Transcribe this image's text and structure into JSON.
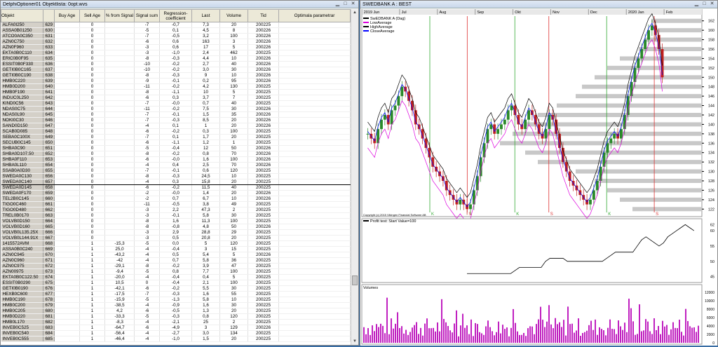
{
  "left_window": {
    "title": "DelphiOptioner01 Objektlista: 0opt.wvs"
  },
  "right_window": {
    "title": "SWEDBANK A : BEST"
  },
  "table": {
    "headers": [
      "Objekt",
      "",
      "Buy Age",
      "Sell Age",
      "% from Signal",
      "Signal sum",
      "Regression-coefficient",
      "Last",
      "Volume",
      "Tid",
      "Optimala parametrar"
    ],
    "rows": [
      [
        "ALFA0I250",
        "629",
        "",
        "0",
        "",
        "-7",
        "-0,7",
        "7,3",
        "20",
        "200225"
      ],
      [
        "ASSA0B01250",
        "630",
        "",
        "0",
        "",
        "-5",
        "0,1",
        "4,5",
        "8",
        "200226"
      ],
      [
        "ATCO0A0C350",
        "631",
        "",
        "0",
        "",
        "-7",
        "-0,5",
        "3,2",
        "100",
        "200226"
      ],
      [
        "AZN0C750",
        "632",
        "",
        "0",
        "",
        "-6",
        "0,6",
        "163",
        "3",
        "200226"
      ],
      [
        "AZN0F960",
        "633",
        "",
        "0",
        "",
        "-3",
        "0,6",
        "17",
        "5",
        "200226"
      ],
      [
        "EKTA0B0C110",
        "634",
        "",
        "0",
        "",
        "-3",
        "-1,0",
        "2,4",
        "462",
        "200225"
      ],
      [
        "ERIC0B0F95",
        "635",
        "",
        "0",
        "",
        "-8",
        "-0,3",
        "4,4",
        "10",
        "200226"
      ],
      [
        "ESSIT0B0F330",
        "636",
        "",
        "0",
        "",
        "-10",
        "-0,2",
        "2,7",
        "40",
        "200226"
      ],
      [
        "GETI0B0C165",
        "637",
        "",
        "0",
        "",
        "-10",
        "-0,2",
        "3,0",
        "30",
        "200226"
      ],
      [
        "GETI0B0C190",
        "638",
        "",
        "0",
        "",
        "-8",
        "-0,3",
        "9",
        "10",
        "200226"
      ],
      [
        "HMB0C220",
        "639",
        "",
        "0",
        "",
        "-9",
        "-0,1",
        "0,2",
        "95",
        "200226"
      ],
      [
        "HMB0D200",
        "640",
        "",
        "0",
        "",
        "-11",
        "-0,2",
        "4,2",
        "130",
        "200225"
      ],
      [
        "HMB0F190",
        "641",
        "",
        "0",
        "",
        "-8",
        "-1,1",
        "10",
        "5",
        "200225"
      ],
      [
        "INDUC0L250",
        "642",
        "",
        "0",
        "",
        "-6",
        "0,3",
        "3,7",
        "7",
        "200225"
      ],
      [
        "KIND0C56",
        "643",
        "",
        "0",
        "",
        "-7",
        "-0,0",
        "0,7",
        "40",
        "200225"
      ],
      [
        "NDAS0C75",
        "644",
        "",
        "0",
        "",
        "-11",
        "-0,2",
        "7,5",
        "30",
        "200226"
      ],
      [
        "NDAS0L90",
        "645",
        "",
        "0",
        "",
        "-7",
        "-0,1",
        "1,5",
        "35",
        "200226"
      ],
      [
        "NOKI0C30",
        "646",
        "",
        "0",
        "",
        "-7",
        "-0,3",
        "8,5",
        "20",
        "200226"
      ],
      [
        "SAND0D150",
        "647",
        "",
        "0",
        "",
        "-4",
        "0,1",
        "1",
        "20",
        "200226"
      ],
      [
        "SCAB0D085",
        "648",
        "",
        "0",
        "",
        "-6",
        "-0,2",
        "0,3",
        "100",
        "200225"
      ],
      [
        "SEBA0C100X",
        "649",
        "",
        "0",
        "",
        "-7",
        "0,1",
        "1,7",
        "20",
        "200225"
      ],
      [
        "SECUB0C145",
        "650",
        "",
        "0",
        "",
        "-6",
        "-1,1",
        "1,2",
        "1",
        "200225"
      ],
      [
        "SHBA0C90",
        "651",
        "",
        "0",
        "",
        "-5",
        "-0,4",
        "12",
        "50",
        "200226"
      ],
      [
        "SHBA0D107.50",
        "652",
        "",
        "0",
        "",
        "-8",
        "-0,2",
        "0,8",
        "70",
        "200226"
      ],
      [
        "SHBA0F110",
        "653",
        "",
        "0",
        "",
        "-6",
        "-0,0",
        "1,6",
        "100",
        "200226"
      ],
      [
        "SHBA0L110",
        "654",
        "",
        "0",
        "",
        "-4",
        "0,4",
        "2,5",
        "70",
        "200226"
      ],
      [
        "SSAB0A0D30",
        "655",
        "",
        "0",
        "",
        "-7",
        "-0,1",
        "0,6",
        "120",
        "200225"
      ],
      [
        "SWEDA0C130",
        "656",
        "",
        "0",
        "",
        "-8",
        "-0,3",
        "24,5",
        "10",
        "200225"
      ],
      [
        "SWEDA0C140",
        "657",
        "",
        "0",
        "",
        "-4",
        "0,3",
        "15,8",
        "20",
        "200225"
      ],
      [
        "SWEDA0D145",
        "658",
        "",
        "0",
        "",
        "-6",
        "-0,2",
        "11,5",
        "40",
        "200225"
      ],
      [
        "SWEDA0F170",
        "659",
        "",
        "0",
        "",
        "-2",
        "-0,0",
        "1,4",
        "20",
        "200226"
      ],
      [
        "TEL2B0C145",
        "660",
        "",
        "0",
        "",
        "-2",
        "0,7",
        "6,7",
        "10",
        "200226"
      ],
      [
        "TIGO0C460",
        "661",
        "",
        "0",
        "",
        "-11",
        "-0,5",
        "3,8",
        "49",
        "200225"
      ],
      [
        "TIGO0D480",
        "662",
        "",
        "0",
        "",
        "-3",
        "2,2",
        "47,3",
        "2",
        "200225"
      ],
      [
        "TREL0B0170",
        "663",
        "",
        "0",
        "",
        "-3",
        "-0,1",
        "5,8",
        "30",
        "200225"
      ],
      [
        "VOLVB0D150",
        "664",
        "",
        "0",
        "",
        "-8",
        "1,6",
        "11,3",
        "100",
        "200225"
      ],
      [
        "VOLVB0D160",
        "665",
        "",
        "0",
        "",
        "-8",
        "-0,8",
        "4,8",
        "50",
        "200226"
      ],
      [
        "VOLVB0L135.25X",
        "666",
        "",
        "0",
        "",
        "-3",
        "2,9",
        "28,8",
        "29",
        "200225"
      ],
      [
        "VOLVB0L144.91X",
        "667",
        "",
        "0",
        "",
        "-3",
        "0,5",
        "20,8",
        "20",
        "200225"
      ],
      [
        "1415572AVM",
        "668",
        "",
        "1",
        "-15,3",
        "-5",
        "0,0",
        "5",
        "120",
        "200225"
      ],
      [
        "ASSA0B0C240",
        "669",
        "",
        "1",
        "25,0",
        "-4",
        "-0,4",
        "3",
        "15",
        "200225"
      ],
      [
        "AZN0C945",
        "670",
        "",
        "1",
        "-43,2",
        "-4",
        "0,5",
        "5,4",
        "5",
        "200226"
      ],
      [
        "AZN0C960",
        "671",
        "",
        "1",
        "-42",
        "-4",
        "0,7",
        "5,8",
        "36",
        "200225"
      ],
      [
        "AZN0C975",
        "672",
        "",
        "1",
        "-29,1",
        "-8",
        "-0,2",
        "3,9",
        "47",
        "200225"
      ],
      [
        "AZN00975",
        "673",
        "",
        "1",
        "-9,4",
        "-5",
        "0,8",
        "7,7",
        "100",
        "200225"
      ],
      [
        "EKTA0B0C122.50",
        "674",
        "",
        "1",
        "-20,0",
        "-4",
        "-0,4",
        "0,4",
        "5",
        "200225"
      ],
      [
        "ESSIT0B0290",
        "675",
        "",
        "1",
        "10,5",
        "0",
        "-0,4",
        "2,1",
        "100",
        "200225"
      ],
      [
        "GETI0B0190",
        "676",
        "",
        "1",
        "-42,1",
        "-6",
        "-0,2",
        "5,5",
        "30",
        "200225"
      ],
      [
        "HEXB0C600",
        "677",
        "",
        "1",
        "-17,5",
        "-7",
        "-0,3",
        "1,6",
        "55",
        "200225"
      ],
      [
        "HMB0C190",
        "678",
        "",
        "1",
        "-15,9",
        "-5",
        "-1,3",
        "5,8",
        "10",
        "200225"
      ],
      [
        "HMB0C200",
        "679",
        "",
        "1",
        "-38,5",
        "-4",
        "-0,9",
        "1,6",
        "30",
        "200225"
      ],
      [
        "HMB0C205",
        "680",
        "",
        "1",
        "4,2",
        "-6",
        "-0,5",
        "1,3",
        "20",
        "200225"
      ],
      [
        "HMB0D220",
        "681",
        "",
        "1",
        "-33,3",
        "-5",
        "-0,3",
        "0,8",
        "120",
        "200225"
      ],
      [
        "HMB0L170",
        "682",
        "",
        "1",
        "-8,3",
        "-4",
        "-2,1",
        "25",
        "2",
        "200225"
      ],
      [
        "INVEB0C525",
        "683",
        "",
        "1",
        "-64,7",
        "-6",
        "-4,9",
        "3",
        "129",
        "200226"
      ],
      [
        "INVEB0C540",
        "684",
        "",
        "1",
        "-56,4",
        "-4",
        "-2,7",
        "3,0",
        "134",
        "200225"
      ],
      [
        "INVEB0C555",
        "685",
        "",
        "1",
        "-46,4",
        "-4",
        "-1,0",
        "1,5",
        "20",
        "200225"
      ]
    ]
  },
  "chart_data": [
    {
      "type": "candlestick",
      "title": "SWEDBANK A (Dag)",
      "legend": [
        "SwEDBANK A (Dag)",
        "LowAverage",
        "HighAverage",
        "CloseAverage"
      ],
      "x_labels": [
        "2019 Jun",
        "Jul",
        "Aug",
        "Sep",
        "Okt",
        "Nov",
        "Dec",
        "2020 Jan",
        "Feb"
      ],
      "y_ticks": [
        122,
        124,
        126,
        128,
        130,
        132,
        134,
        136,
        138,
        140,
        142,
        144,
        146,
        148,
        150,
        152,
        154,
        156,
        158,
        160,
        162
      ],
      "ylim": [
        121,
        163
      ],
      "close": [
        138,
        137,
        136,
        139,
        141,
        142,
        140,
        143,
        144,
        146,
        148,
        147,
        145,
        143,
        140,
        139,
        137,
        135,
        133,
        131,
        130,
        129,
        128,
        126,
        125,
        124,
        123,
        124,
        123,
        122,
        123,
        126,
        129,
        133,
        136,
        139,
        140,
        138,
        139,
        140,
        141,
        143,
        144,
        142,
        140,
        139,
        141,
        143,
        142,
        140,
        138,
        137,
        139,
        142,
        141,
        138,
        135,
        132,
        130,
        128,
        127,
        126,
        125,
        124,
        123,
        124,
        126,
        128,
        131,
        134,
        136,
        137,
        138,
        137,
        139,
        142,
        146,
        149,
        152,
        154,
        156,
        158,
        160,
        161,
        159,
        156,
        150
      ],
      "signals": [
        {
          "label": "K",
          "x": 0.2
        },
        {
          "label": "S",
          "x": 0.31
        },
        {
          "label": "K",
          "x": 0.45
        },
        {
          "label": "S",
          "x": 0.55
        },
        {
          "label": "K",
          "x": 0.72
        },
        {
          "label": "S",
          "x": 0.86
        }
      ],
      "copyright": "Copyright (c) 2015 Vikingen Financial Software AB"
    },
    {
      "type": "line",
      "title": "Profit test: Start Value=100",
      "y_ticks": [
        45,
        50,
        55,
        60,
        62
      ],
      "ylim": [
        44,
        63
      ],
      "values": [
        46,
        46,
        46,
        46,
        46,
        46,
        46,
        46,
        46,
        46,
        46,
        47,
        48,
        48,
        48,
        48,
        48,
        48,
        50,
        51,
        51,
        51,
        51,
        50,
        50,
        50,
        50,
        50,
        50,
        50,
        50,
        50,
        51,
        52,
        53,
        53,
        53,
        53,
        53,
        55,
        57,
        58,
        57,
        56,
        55,
        56,
        58,
        59,
        60,
        61,
        62,
        61,
        60
      ]
    },
    {
      "type": "bar",
      "title": "Volumes",
      "y_ticks": [
        0,
        2000,
        4000,
        6000,
        8000,
        10000,
        12000
      ],
      "ylim": [
        0,
        12500
      ]
    }
  ]
}
